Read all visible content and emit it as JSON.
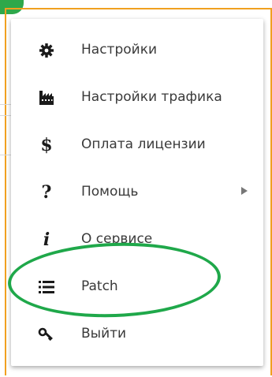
{
  "menu": {
    "items": [
      {
        "label": "Настройки",
        "icon": "gear-icon"
      },
      {
        "label": "Настройки трафика",
        "icon": "traffic-factory-icon"
      },
      {
        "label": "Оплата лицензии",
        "icon": "dollar-icon",
        "glyph": "$"
      },
      {
        "label": "Помощь",
        "icon": "question-icon",
        "glyph": "?",
        "has_submenu": true
      },
      {
        "label": "О сервисе",
        "icon": "info-icon",
        "glyph": "i"
      },
      {
        "label": "Patch",
        "icon": "list-icon",
        "highlighted": true
      },
      {
        "label": "Выйти",
        "icon": "key-icon"
      }
    ]
  },
  "highlight_color": "#1fa84a",
  "border_color": "#f0a020"
}
